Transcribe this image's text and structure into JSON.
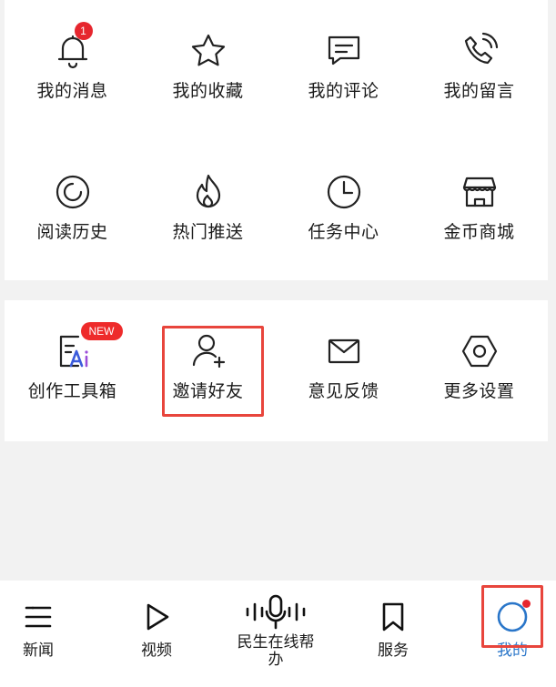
{
  "grid1": [
    {
      "label": "我的消息",
      "icon": "bell-icon",
      "badge": "1"
    },
    {
      "label": "我的收藏",
      "icon": "star-icon"
    },
    {
      "label": "我的评论",
      "icon": "comment-icon"
    },
    {
      "label": "我的留言",
      "icon": "phone-icon"
    },
    {
      "label": "阅读历史",
      "icon": "history-icon"
    },
    {
      "label": "热门推送",
      "icon": "flame-icon"
    },
    {
      "label": "任务中心",
      "icon": "clock-icon"
    },
    {
      "label": "金币商城",
      "icon": "shop-icon"
    }
  ],
  "grid2": [
    {
      "label": "创作工具箱",
      "icon": "ai-tool-icon",
      "badge": "NEW"
    },
    {
      "label": "邀请好友",
      "icon": "add-user-icon"
    },
    {
      "label": "意见反馈",
      "icon": "mail-icon"
    },
    {
      "label": "更多设置",
      "icon": "settings-hexagon-icon"
    }
  ],
  "tabbar": {
    "items": [
      {
        "label": "新闻",
        "icon": "news-list-icon"
      },
      {
        "label": "视频",
        "icon": "play-icon"
      },
      {
        "label": "民生在线帮办",
        "icon": "microphone-icon"
      },
      {
        "label": "服务",
        "icon": "bookmark-icon"
      },
      {
        "label": "我的",
        "icon": "profile-circle-icon",
        "active": true
      }
    ]
  },
  "colors": {
    "accent": "#2a76c9",
    "badge": "#e6262e",
    "highlight": "#e8453c",
    "page_bg": "#f2f2f2"
  }
}
